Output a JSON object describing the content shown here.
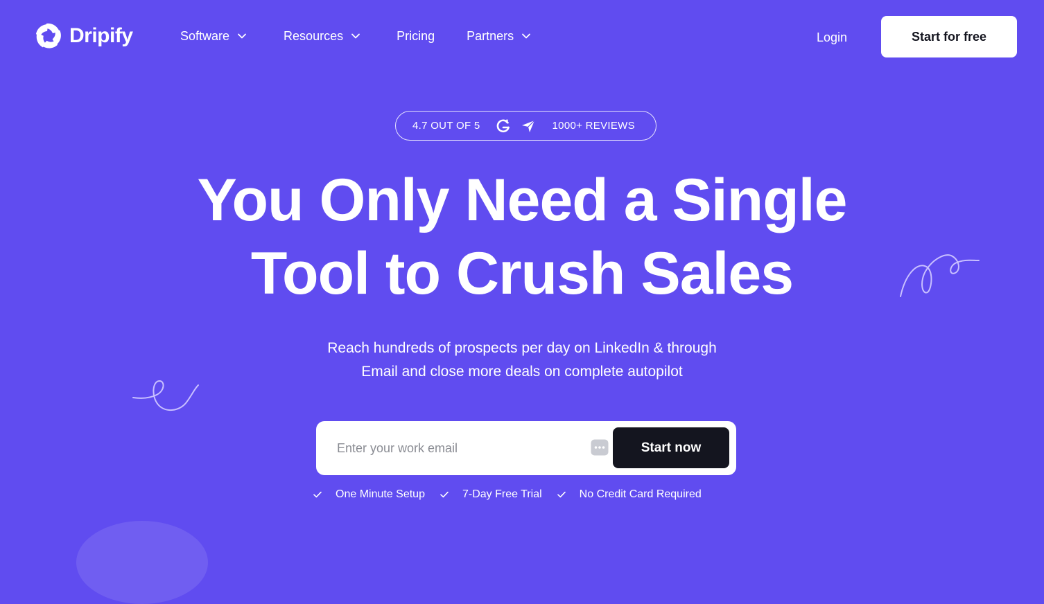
{
  "brand": {
    "name": "Dripify",
    "icon": "aperture-logo-icon"
  },
  "nav": {
    "items": [
      {
        "label": "Software",
        "has_dropdown": true
      },
      {
        "label": "Resources",
        "has_dropdown": true
      },
      {
        "label": "Pricing",
        "has_dropdown": false
      },
      {
        "label": "Partners",
        "has_dropdown": true
      }
    ],
    "login_label": "Login",
    "cta_label": "Start for free"
  },
  "rating": {
    "score_text": "4.7 OUT OF 5",
    "badges": [
      "g2-icon",
      "capterra-icon"
    ],
    "reviews_text": "1000+ REVIEWS"
  },
  "hero": {
    "headline_line1": "You Only Need a Single",
    "headline_line2": "Tool to Crush Sales",
    "subtitle_line1": "Reach hundreds of prospects per day on LinkedIn & through",
    "subtitle_line2": "Email and close more deals on complete autopilot"
  },
  "form": {
    "email_placeholder": "Enter your work email",
    "email_value": "",
    "autofill_icon": "password-manager-icon",
    "submit_label": "Start now"
  },
  "perks": [
    "One Minute Setup",
    "7-Day Free Trial",
    "No Credit Card Required"
  ],
  "colors": {
    "background": "#604cf0",
    "text": "#ffffff",
    "dark_button": "#14151f",
    "light_button": "#ffffff"
  }
}
